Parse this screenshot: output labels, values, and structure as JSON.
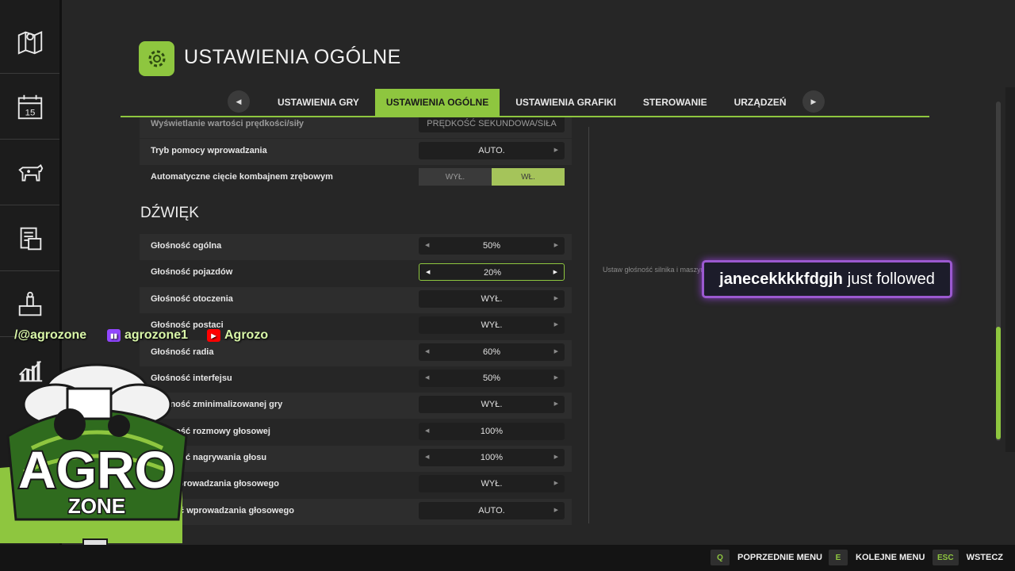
{
  "header": {
    "title": "USTAWIENIA OGÓLNE",
    "icon": "gear-icon"
  },
  "tabs": [
    {
      "label": "USTAWIENIA GRY",
      "active": false
    },
    {
      "label": "USTAWIENIA OGÓLNE",
      "active": true
    },
    {
      "label": "USTAWIENIA GRAFIKI",
      "active": false
    },
    {
      "label": "STEROWANIE",
      "active": false
    },
    {
      "label": "URZĄDZEŃ",
      "active": false
    }
  ],
  "settings_top": {
    "r0": {
      "label": "Wyświetlanie wartości prędkości/siły",
      "value": "PRĘDKOŚĆ SEKUNDOWA/SIŁA"
    },
    "r1": {
      "label": "Tryb pomocy wprowadzania",
      "value": "AUTO."
    },
    "r2": {
      "label": "Automatyczne cięcie kombajnem zrębowym",
      "off_label": "WYŁ.",
      "on_label": "WŁ."
    }
  },
  "section": {
    "title": "DŹWIĘK"
  },
  "sound": {
    "r0": {
      "label": "Głośność ogólna",
      "value": "50%"
    },
    "r1": {
      "label": "Głośność pojazdów",
      "value": "20%"
    },
    "r2": {
      "label": "Głośność otoczenia",
      "value": "WYŁ."
    },
    "r3": {
      "label": "Głośność postaci",
      "value": "WYŁ."
    },
    "r4": {
      "label": "Głośność radia",
      "value": "60%"
    },
    "r5": {
      "label": "Głośność interfejsu",
      "value": "50%"
    },
    "r6": {
      "label": "Głośność zminimalizowanej gry",
      "value": "WYŁ."
    },
    "r7": {
      "label": "Głośność rozmowy głosowej",
      "value": "100%"
    },
    "r8": {
      "label": "Głośność nagrywania głosu",
      "value": "100%"
    },
    "r9": {
      "label": "Tryb wprowadzania głosowego",
      "value": "WYŁ."
    },
    "r10": {
      "label": "Czułość wprowadzania głosowego",
      "value": "AUTO."
    }
  },
  "description": "Ustaw głośność silnika i maszyn.",
  "notification": {
    "user": "janecekkkkfdgjh",
    "text": "just followed"
  },
  "socials": {
    "tiktok": "/@agrozone",
    "twitch": "agrozone1",
    "youtube": "Agrozo"
  },
  "logo": {
    "line1": "AGRO",
    "line2": "ZONE"
  },
  "sidebar": [
    "map-icon",
    "calendar-icon",
    "cow-icon",
    "contracts-icon",
    "production-icon",
    "stats-chart-icon"
  ],
  "calendar_day": "15",
  "bottom": {
    "prev": {
      "key": "Q",
      "label": "POPRZEDNIE MENU"
    },
    "next": {
      "key": "E",
      "label": "KOLEJNE MENU"
    },
    "back": {
      "key": "ESC",
      "label": "WSTECZ"
    }
  },
  "colors": {
    "accent": "#8ec63f",
    "background": "#262626",
    "notification_border": "#9b59d0"
  }
}
